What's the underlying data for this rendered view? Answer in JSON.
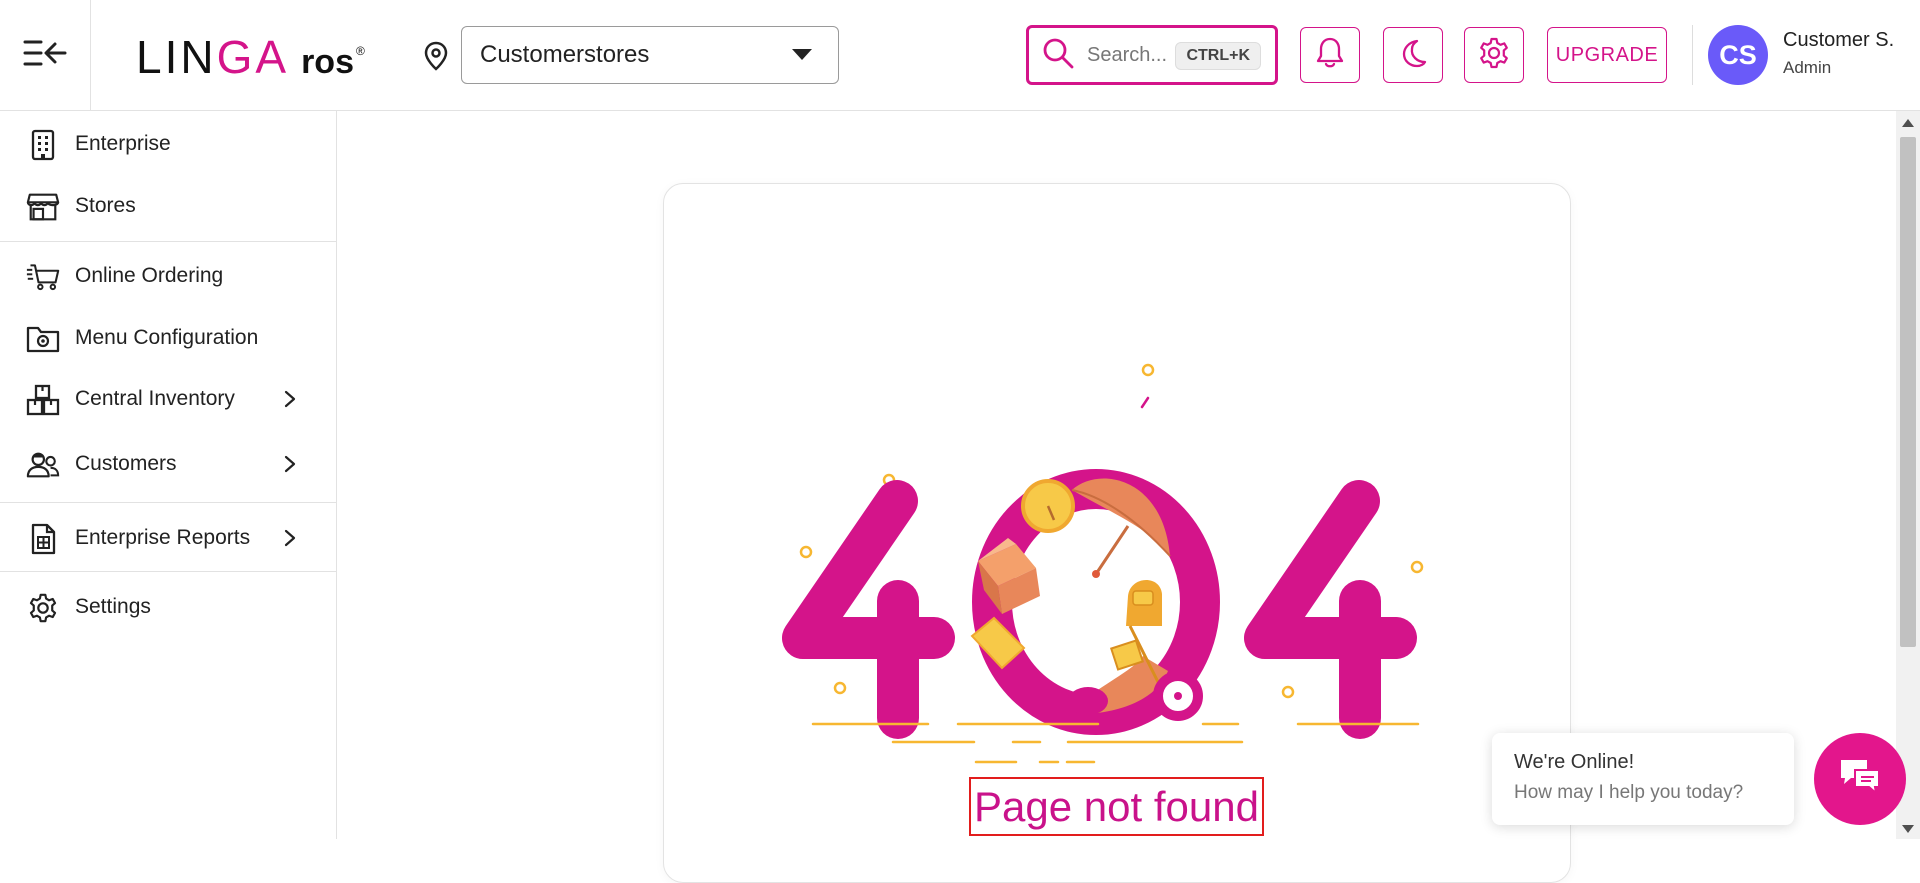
{
  "header": {
    "logo_text": "LINGA",
    "logo_suffix": "ros",
    "logo_reg": "®",
    "store_selector": {
      "value": "Customerstores"
    },
    "search": {
      "placeholder": "Search...",
      "shortcut": "CTRL+K"
    },
    "upgrade_label": "UPGRADE",
    "user": {
      "initials": "CS",
      "name": "Customer S.",
      "role": "Admin"
    },
    "accent_color": "#d4148a"
  },
  "sidebar": {
    "items": [
      {
        "label": "Enterprise",
        "icon": "building-icon"
      },
      {
        "label": "Stores",
        "icon": "store-icon"
      },
      {
        "label": "Online Ordering",
        "icon": "cart-icon"
      },
      {
        "label": "Menu Configuration",
        "icon": "folder-gear-icon"
      },
      {
        "label": "Central Inventory",
        "icon": "boxes-icon",
        "expandable": true
      },
      {
        "label": "Customers",
        "icon": "customers-icon",
        "expandable": true
      },
      {
        "label": "Enterprise Reports",
        "icon": "report-icon",
        "expandable": true
      },
      {
        "label": "Settings",
        "icon": "gear-icon"
      }
    ]
  },
  "main": {
    "error_code": "404",
    "message": "Page not found"
  },
  "chat": {
    "title": "We're Online!",
    "subtitle": "How may I help you today?"
  }
}
